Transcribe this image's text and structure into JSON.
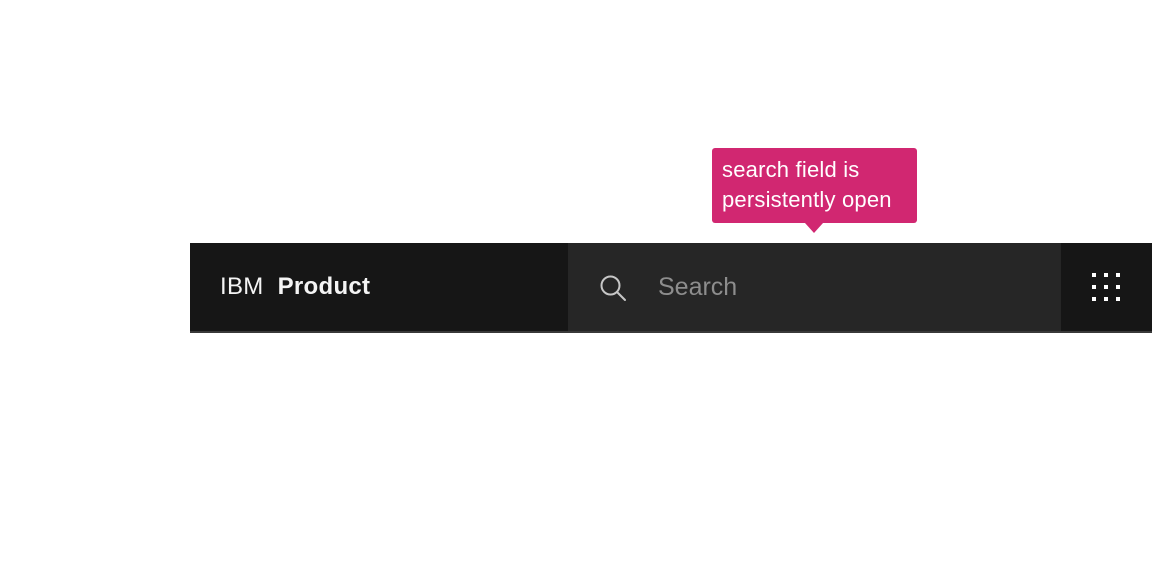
{
  "annotation": {
    "lines": [
      "search field is",
      "persistently open"
    ],
    "color": "#d12771"
  },
  "header": {
    "brand_prefix": "IBM",
    "brand_name": "Product",
    "background": "#161616"
  },
  "search": {
    "placeholder": "Search",
    "value": "",
    "icon": "search-icon",
    "background": "#262626"
  },
  "actions": {
    "switcher_icon": "app-switcher-icon"
  }
}
